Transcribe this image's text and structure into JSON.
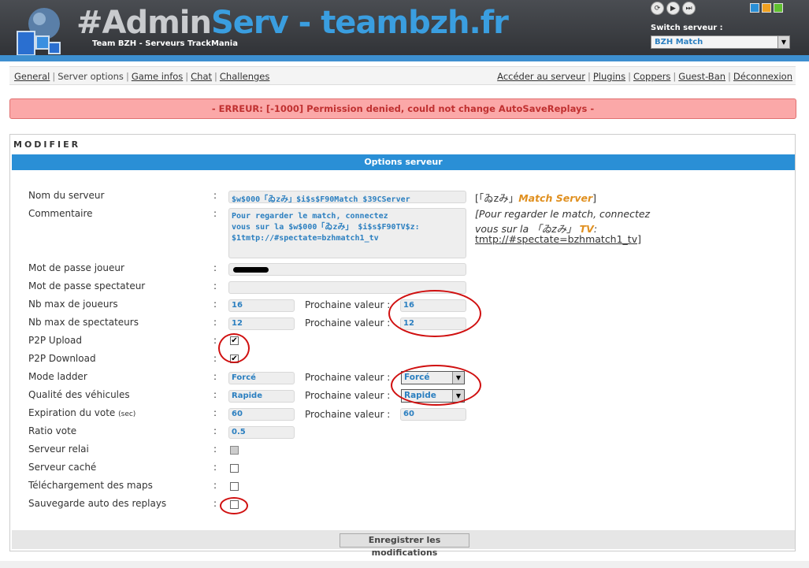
{
  "header": {
    "title_part1": "#Admin",
    "title_part2": "Serv",
    "title_part3": " - teambzh.fr",
    "subtitle": "Team BZH - Serveurs TrackMania",
    "switch_label": "Switch serveur :",
    "switch_value": "BZH Match",
    "theme_colors": [
      "#2a8fd6",
      "#f0a020",
      "#60c030"
    ]
  },
  "menu": {
    "left": [
      "General",
      "Server options",
      "Game infos",
      "Chat",
      "Challenges"
    ],
    "right": [
      "Accéder au serveur",
      "Plugins",
      "Coppers",
      "Guest-Ban",
      "Déconnexion"
    ]
  },
  "error": {
    "text": "- ERREUR: [-1000] Permission denied, could not change AutoSaveReplays -"
  },
  "panel": {
    "title": "MODIFIER",
    "section_title": "Options serveur",
    "next_value_label": "Prochaine valeur :",
    "save_label": "Enregistrer les modifications"
  },
  "fields": {
    "server_name_label": "Nom du serveur",
    "server_name_value": "$w$000「ゐzみ」$i$s$F90Match $39CServer",
    "server_name_preview_a": "[「ゐzみ」",
    "server_name_preview_b": "Match Server",
    "server_name_preview_c": "]",
    "comment_label": "Commentaire",
    "comment_value": "Pour regarder le match, connectez\nvous sur la $w$000「ゐzみ」 $i$s$F90TV$z:\n$1tmtp://#spectate=bzhmatch1_tv",
    "comment_preview_line1": "[Pour regarder le match, connectez",
    "comment_preview_line2a": "vous sur la 「ゐzみ」",
    "comment_preview_line2b": "TV",
    "comment_preview_line2c": ":",
    "comment_preview_line3": "tmtp://#spectate=bzhmatch1_tv]",
    "player_pwd_label": "Mot de passe joueur",
    "spectator_pwd_label": "Mot de passe spectateur",
    "max_players_label": "Nb max de joueurs",
    "max_players_value": "16",
    "max_players_next": "16",
    "max_spectators_label": "Nb max de spectateurs",
    "max_spectators_value": "12",
    "max_spectators_next": "12",
    "p2p_upload_label": "P2P Upload",
    "p2p_download_label": "P2P Download",
    "ladder_mode_label": "Mode ladder",
    "ladder_mode_value": "Forcé",
    "ladder_mode_next": "Forcé",
    "vehicle_quality_label": "Qualité des véhicules",
    "vehicle_quality_value": "Rapide",
    "vehicle_quality_next": "Rapide",
    "vote_timeout_label": "Expiration du vote",
    "vote_timeout_unit": "(sec)",
    "vote_timeout_value": "60",
    "vote_timeout_next": "60",
    "vote_ratio_label": "Ratio vote",
    "vote_ratio_value": "0.5",
    "relay_label": "Serveur relai",
    "hidden_label": "Serveur caché",
    "map_download_label": "Téléchargement des maps",
    "autosave_label": "Sauvegarde auto des replays"
  },
  "checkboxes": {
    "p2p_upload": "✔",
    "p2p_download": "✔"
  }
}
